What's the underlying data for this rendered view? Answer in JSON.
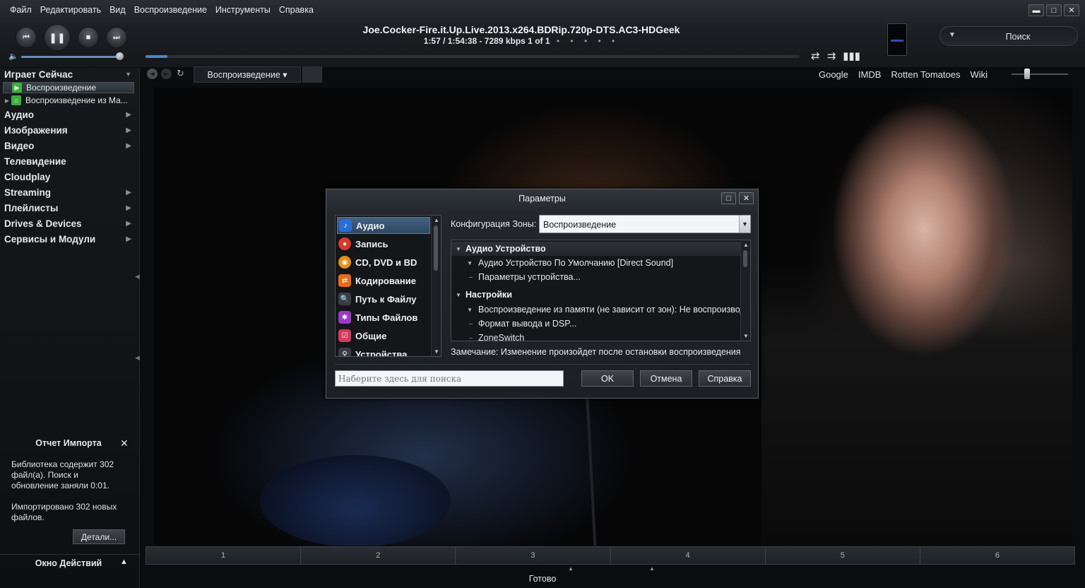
{
  "menu": [
    "Файл",
    "Редактировать",
    "Вид",
    "Воспроизведение",
    "Инструменты",
    "Справка"
  ],
  "window_controls": {
    "minimize": "▬",
    "maximize": "□",
    "close": "✕"
  },
  "player": {
    "title": "Joe.Cocker-Fire.it.Up.Live.2013.x264.BDRip.720p-DTS.AC3-HDGeek",
    "info": "1:57 / 1:54:38 - 7289 kbps   1 of 1",
    "dots": "• • • • •",
    "progress_fraction": 0.017,
    "volume_fraction": 0.95
  },
  "search": {
    "label": "Поиск"
  },
  "nav": {
    "tab_label": "Воспроизведение ▾",
    "links": [
      "Google",
      "IMDB",
      "Rotten Tomatoes",
      "Wiki"
    ]
  },
  "sidebar": {
    "header": "Играет Сейчас",
    "sub_items": [
      {
        "label": "Воспроизведение",
        "selected": true,
        "icon": "play-icon",
        "color": "#3cae3c"
      },
      {
        "label": "Воспроизведение из Ма...",
        "selected": false,
        "icon": "network-icon",
        "color": "#3cae3c"
      }
    ],
    "items": [
      {
        "label": "Аудио",
        "has_children": true
      },
      {
        "label": "Изображения",
        "has_children": true
      },
      {
        "label": "Видео",
        "has_children": true
      },
      {
        "label": "Телевидение",
        "has_children": false
      },
      {
        "label": "Cloudplay",
        "has_children": false
      },
      {
        "label": "Streaming",
        "has_children": true
      },
      {
        "label": "Плейлисты",
        "has_children": true
      },
      {
        "label": "Drives & Devices",
        "has_children": true
      },
      {
        "label": "Сервисы и Модули",
        "has_children": true
      }
    ]
  },
  "import_report": {
    "title": "Отчет Импорта",
    "text1": "Библиотека содержит 302 файл(а). Поиск и обновление заняли 0:01.",
    "text2": "Импортировано 302 новых файлов.",
    "details_button": "Детали..."
  },
  "action_window": {
    "title": "Окно Действий"
  },
  "chapters": [
    "1",
    "2",
    "3",
    "4",
    "5",
    "6"
  ],
  "status": "Готово",
  "dialog": {
    "title": "Параметры",
    "categories": [
      {
        "label": "Аудио",
        "icon": "music-note-icon",
        "color": "#2a6fd6",
        "selected": true
      },
      {
        "label": "Запись",
        "icon": "record-icon",
        "color": "#d63a2a",
        "selected": false
      },
      {
        "label": "CD, DVD и BD",
        "icon": "disc-icon",
        "color": "#e8901a",
        "selected": false
      },
      {
        "label": "Кодирование",
        "icon": "encode-icon",
        "color": "#e86a1a",
        "selected": false
      },
      {
        "label": "Путь к Файлу",
        "icon": "file-path-icon",
        "color": "#3a3e44",
        "selected": false
      },
      {
        "label": "Типы Файлов",
        "icon": "file-types-icon",
        "color": "#9a3ac8",
        "selected": false
      },
      {
        "label": "Общие",
        "icon": "checkbox-icon",
        "color": "#d63a5a",
        "selected": false
      },
      {
        "label": "Устройства",
        "icon": "device-icon",
        "color": "#3a3e44",
        "selected": false
      }
    ],
    "zone_label": "Конфигурация Зоны:",
    "zone_value": "Воспроизведение",
    "tree": [
      {
        "type": "header",
        "label": "Аудио Устройство"
      },
      {
        "type": "sub-tri",
        "label": "Аудио Устройство По Умолчанию [Direct Sound]"
      },
      {
        "type": "sub-dash",
        "label": "Параметры устройства..."
      },
      {
        "type": "header2",
        "label": "Настройки"
      },
      {
        "type": "sub-tri",
        "label": "Воспроизведение из памяти (не зависит от зон): Не воспроизвод..."
      },
      {
        "type": "sub-dash",
        "label": "Формат вывода и DSP..."
      },
      {
        "type": "sub-dash",
        "label": "ZoneSwitch"
      }
    ],
    "note": "Замечание: Изменение произойдет после остановки воспроизведения",
    "search_placeholder": "Наберите здесь для поиска",
    "ok": "OK",
    "cancel": "Отмена",
    "help": "Справка"
  }
}
